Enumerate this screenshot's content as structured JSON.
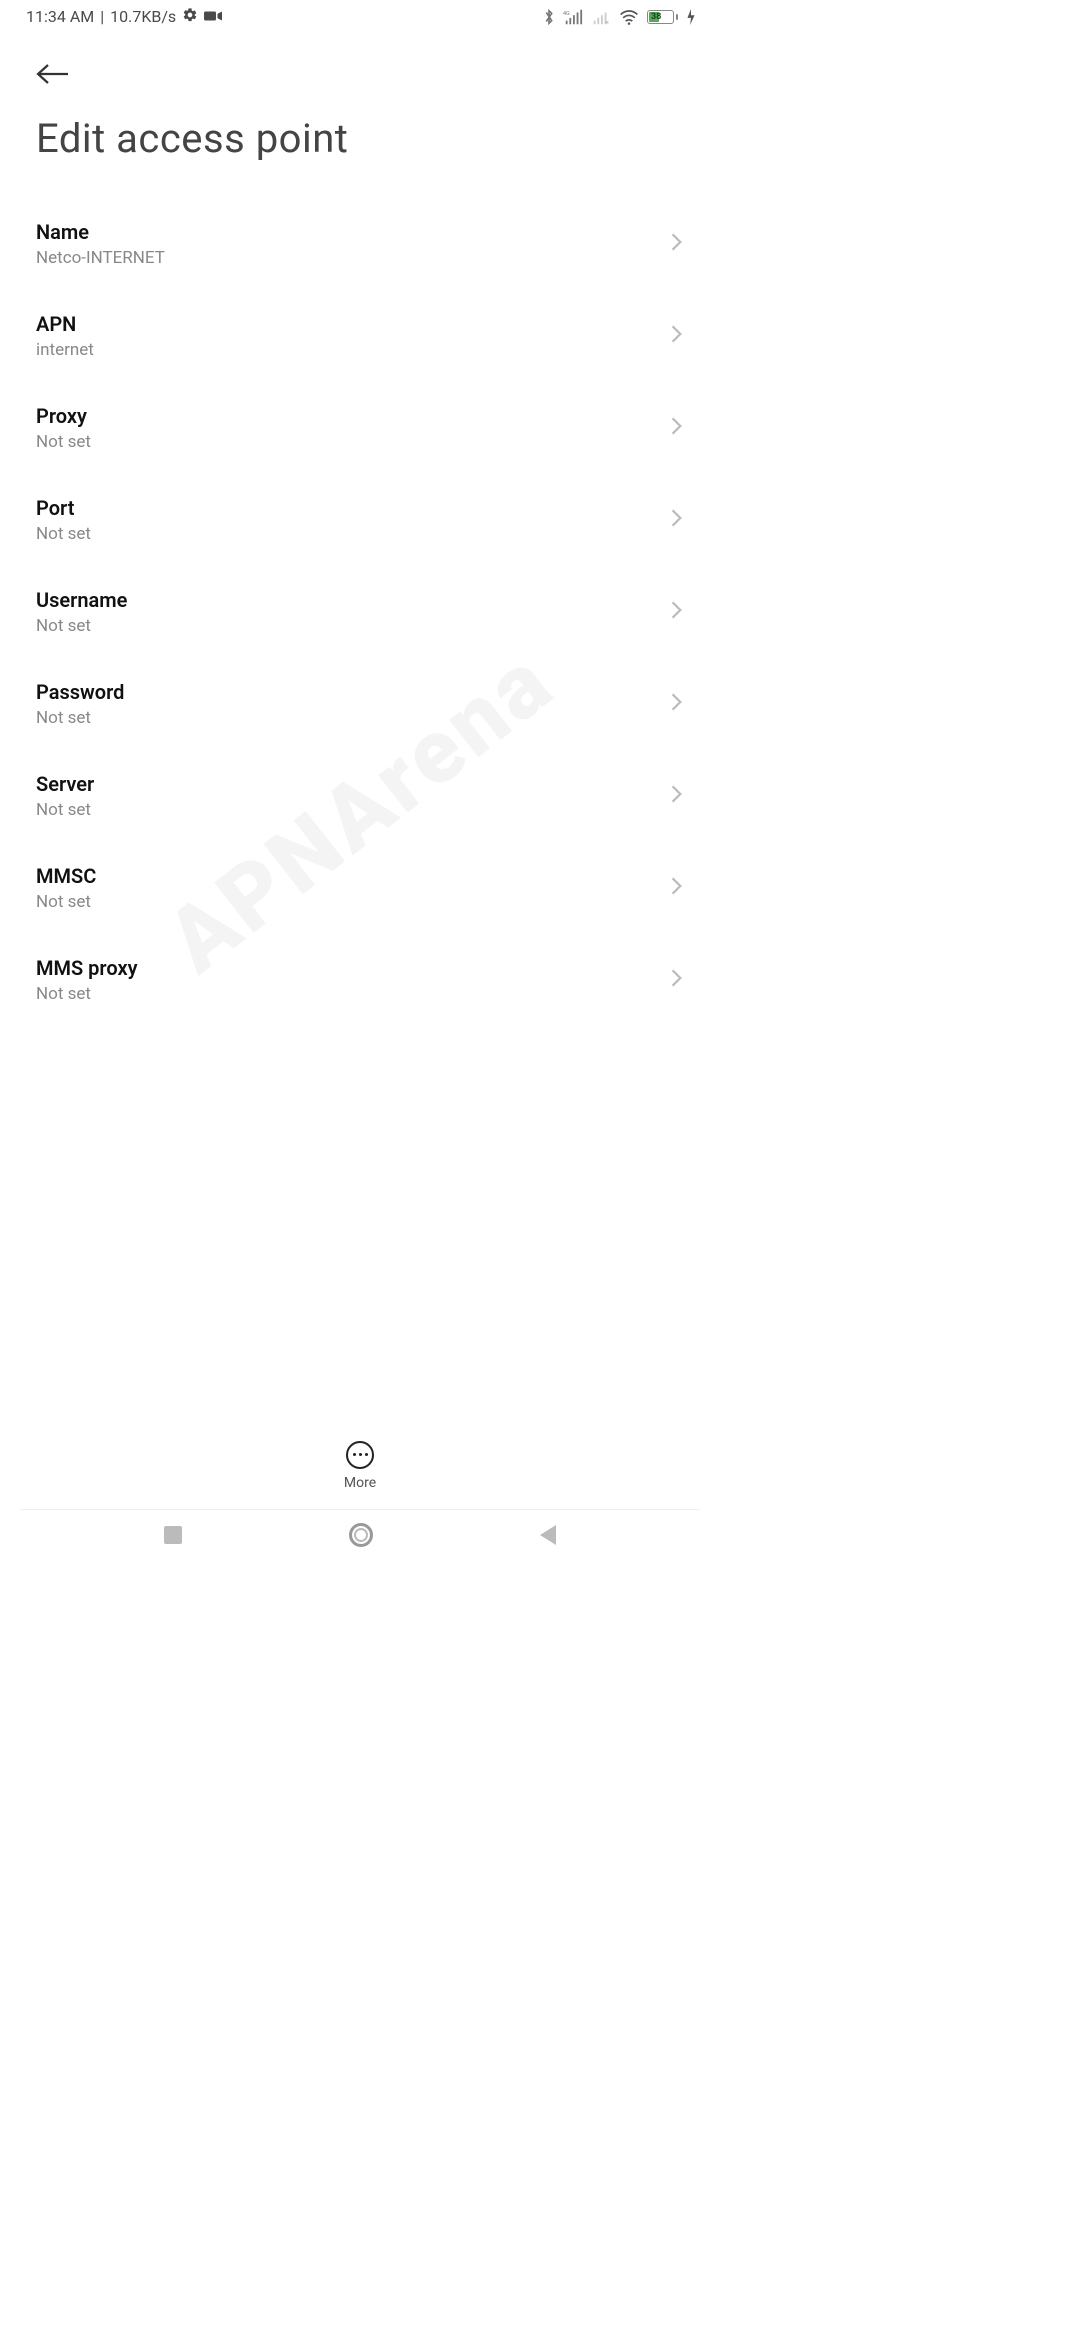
{
  "status_bar": {
    "time": "11:34 AM",
    "net_speed": "10.7KB/s",
    "battery_percent": "38"
  },
  "page": {
    "title": "Edit access point"
  },
  "more_label": "More",
  "watermark": "APNArena",
  "rows": [
    {
      "title": "Name",
      "value": "Netco-INTERNET"
    },
    {
      "title": "APN",
      "value": "internet"
    },
    {
      "title": "Proxy",
      "value": "Not set"
    },
    {
      "title": "Port",
      "value": "Not set"
    },
    {
      "title": "Username",
      "value": "Not set"
    },
    {
      "title": "Password",
      "value": "Not set"
    },
    {
      "title": "Server",
      "value": "Not set"
    },
    {
      "title": "MMSC",
      "value": "Not set"
    },
    {
      "title": "MMS proxy",
      "value": "Not set"
    }
  ]
}
